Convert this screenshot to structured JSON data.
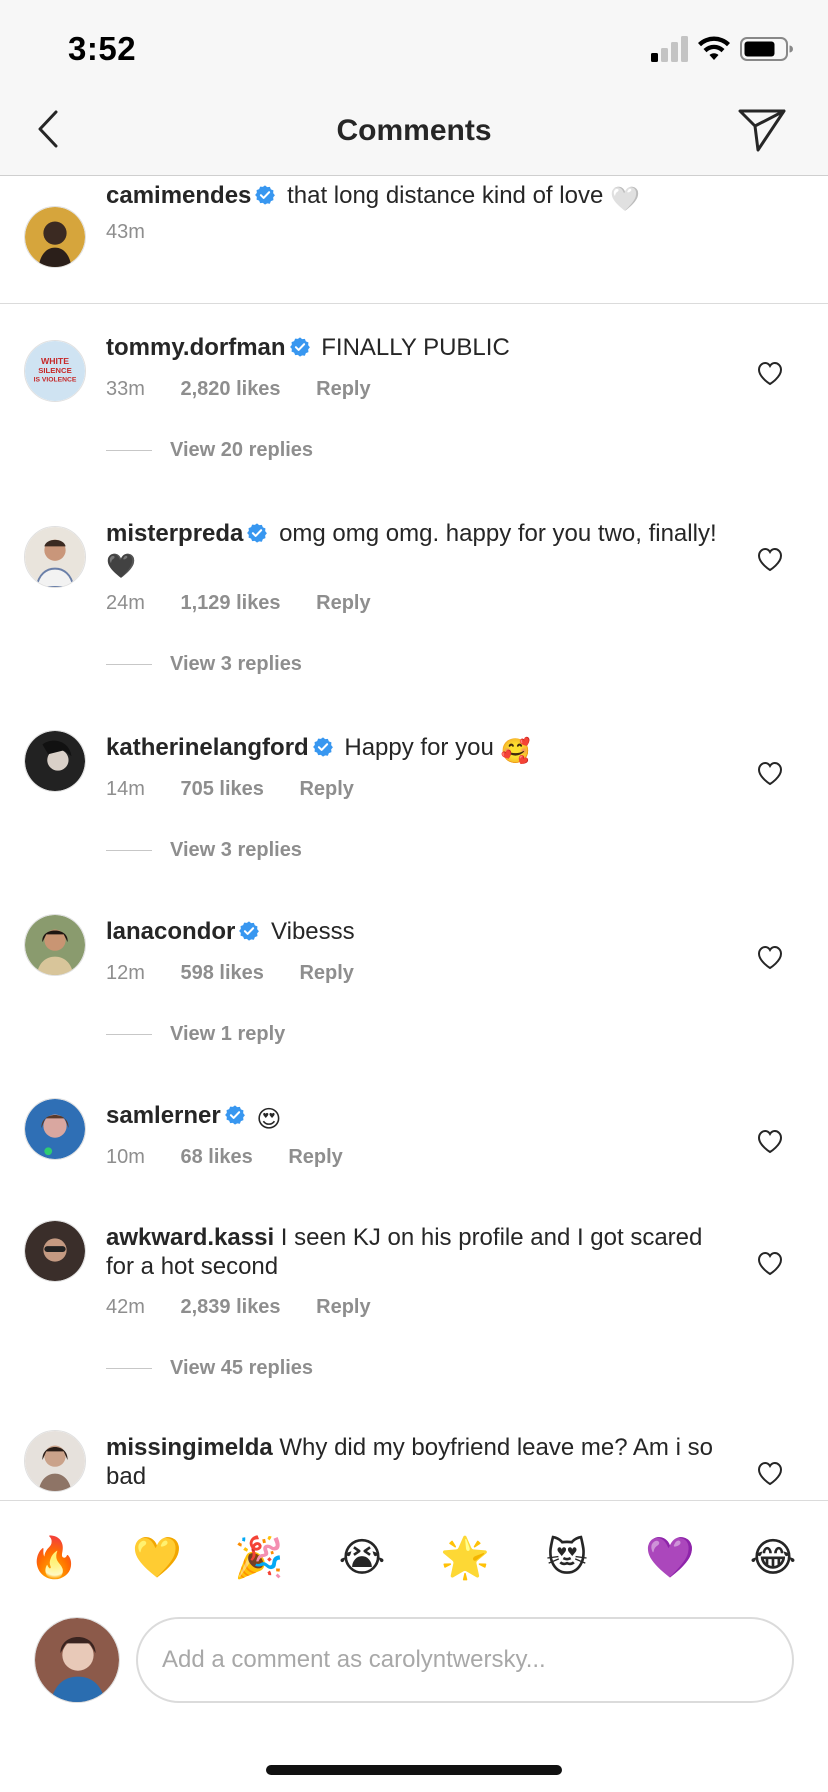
{
  "status_bar": {
    "time": "3:52",
    "icons": [
      "cellular-signal-icon",
      "wifi-icon",
      "battery-icon"
    ]
  },
  "header": {
    "title": "Comments",
    "back_icon": "chevron-left-icon",
    "share_icon": "paper-plane-icon"
  },
  "caption": {
    "username": "camimendes",
    "verified": true,
    "text": "that long distance kind of love",
    "emoji": "🤍",
    "time": "43m"
  },
  "comments": [
    {
      "username": "tommy.dorfman",
      "verified": true,
      "text": "FINALLY PUBLIC",
      "emoji": "",
      "time": "33m",
      "likes": "2,820 likes",
      "reply_label": "Reply",
      "view_replies": "View 20 replies"
    },
    {
      "username": "misterpreda",
      "verified": true,
      "text": "omg omg omg. happy for you two, finally!",
      "emoji": "🖤",
      "time": "24m",
      "likes": "1,129 likes",
      "reply_label": "Reply",
      "view_replies": "View 3 replies"
    },
    {
      "username": "katherinelangford",
      "verified": true,
      "text": "Happy for you",
      "emoji": "🥰",
      "time": "14m",
      "likes": "705 likes",
      "reply_label": "Reply",
      "view_replies": "View 3 replies"
    },
    {
      "username": "lanacondor",
      "verified": true,
      "text": "Vibesss",
      "emoji": "",
      "time": "12m",
      "likes": "598 likes",
      "reply_label": "Reply",
      "view_replies": "View 1 reply"
    },
    {
      "username": "samlerner",
      "verified": true,
      "text": "",
      "emoji": "😍",
      "time": "10m",
      "likes": "68 likes",
      "reply_label": "Reply",
      "view_replies": ""
    },
    {
      "username": "awkward.kassi",
      "verified": false,
      "text": "I seen KJ on his profile and I got scared for a hot second",
      "emoji": "",
      "time": "42m",
      "likes": "2,839 likes",
      "reply_label": "Reply",
      "view_replies": "View 45 replies"
    },
    {
      "username": "missingimelda",
      "verified": false,
      "text": "Why did my boyfriend leave me? Am i so bad",
      "emoji": "",
      "time": "",
      "likes": "",
      "reply_label": "",
      "view_replies": ""
    }
  ],
  "quick_emojis": [
    "🔥",
    "💛",
    "🎉",
    "😭",
    "🌟",
    "😻",
    "💜",
    "😂"
  ],
  "input": {
    "placeholder": "Add a comment as carolyntwersky..."
  },
  "colors": {
    "verified_blue": "#3897f0",
    "meta_gray": "#8e8e8e",
    "text": "#262626"
  }
}
